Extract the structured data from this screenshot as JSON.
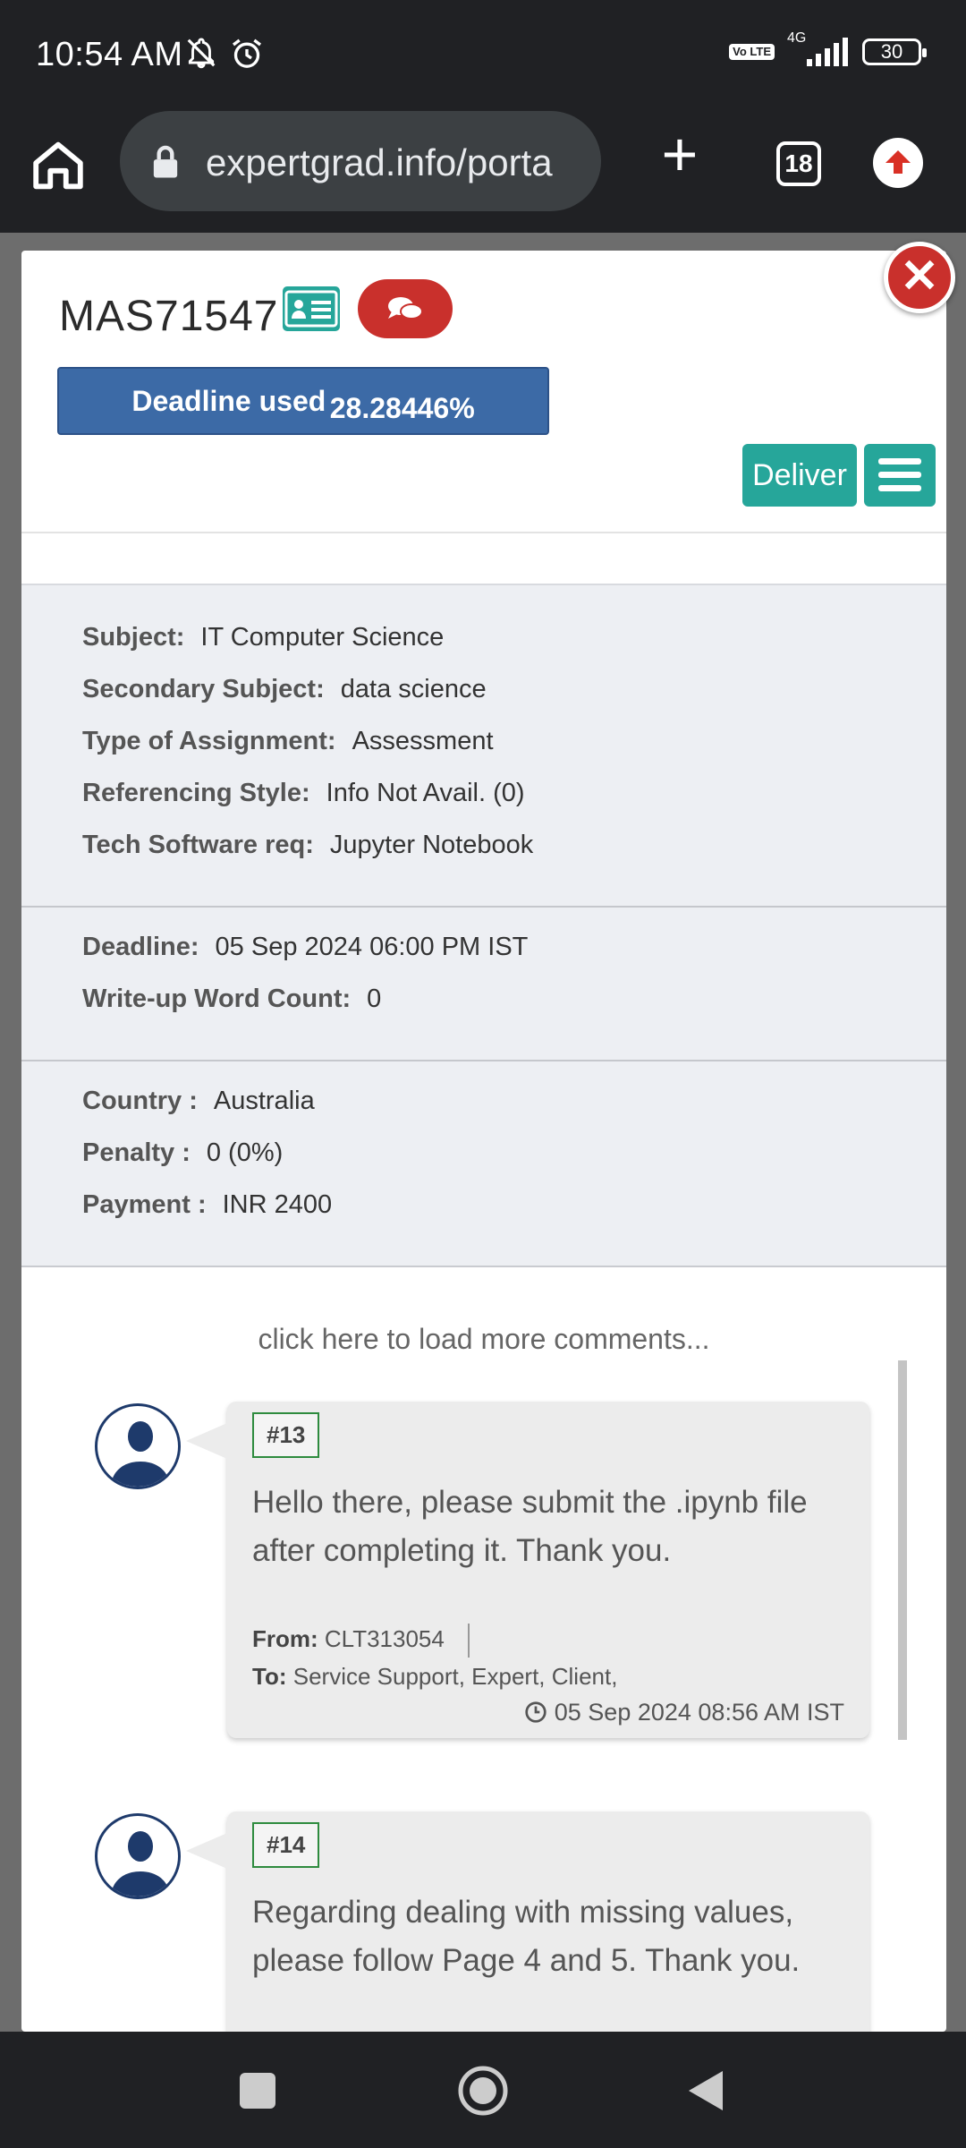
{
  "status_bar": {
    "time": "10:54 AM",
    "network": "4G",
    "volte": "Vo LTE",
    "battery": "30"
  },
  "browser": {
    "url": "expertgrad.info/porta",
    "tab_count": "18"
  },
  "modal": {
    "order_id": "MAS71547",
    "deadline_label": "Deadline used",
    "deadline_value": "28.28446%",
    "deadline_used_fraction": 0.2828446,
    "deliver_label": "Deliver",
    "close_symbol": "✕",
    "details": [
      {
        "key": "Subject:",
        "value": "IT Computer Science"
      },
      {
        "key": "Secondary Subject:",
        "value": "data science"
      },
      {
        "key": "Type of Assignment:",
        "value": "Assessment"
      },
      {
        "key": "Referencing Style:",
        "value": "Info Not Avail. (0)"
      },
      {
        "key": "Tech Software req:",
        "value": "Jupyter Notebook"
      }
    ],
    "schedule": [
      {
        "key": "Deadline:",
        "value": "05 Sep 2024 06:00 PM IST"
      },
      {
        "key": "Write-up Word Count:",
        "value": "0"
      }
    ],
    "billing": [
      {
        "key": "Country :",
        "value": "Australia"
      },
      {
        "key": "Penalty :",
        "value": "0 (0%)"
      },
      {
        "key": "Payment :",
        "value": "INR 2400"
      }
    ],
    "load_more": "click here to load more comments...",
    "comments": [
      {
        "number": "#13",
        "message": "Hello there, please submit the .ipynb file after completing it. Thank you.",
        "from_label": "From:",
        "from": "CLT313054",
        "to_label": "To:",
        "to": "Service Support, Expert, Client,",
        "date": "05 Sep 2024 08:56 AM IST"
      },
      {
        "number": "#14",
        "message": "Regarding dealing with missing values, please follow Page 4 and 5. Thank you."
      }
    ]
  },
  "colors": {
    "accent_teal": "#26a69a",
    "danger_red": "#c9302c",
    "deadline_blue": "#3c6aa6",
    "badge_green": "#2e8b3e"
  }
}
